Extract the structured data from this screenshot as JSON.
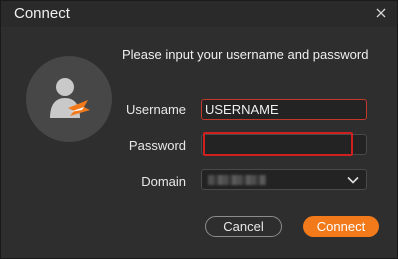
{
  "window": {
    "title": "Connect"
  },
  "form": {
    "prompt": "Please input your username and password",
    "username_label": "Username",
    "username_value": "USERNAME",
    "password_label": "Password",
    "password_value": "",
    "domain_label": "Domain"
  },
  "buttons": {
    "cancel": "Cancel",
    "connect": "Connect"
  },
  "colors": {
    "accent": "#f27a1a",
    "error": "#d01f1f",
    "background": "#2e2e2e"
  },
  "icons": {
    "close": "close-icon",
    "avatar": "user-avatar-icon",
    "dropdown": "chevron-down-icon"
  }
}
